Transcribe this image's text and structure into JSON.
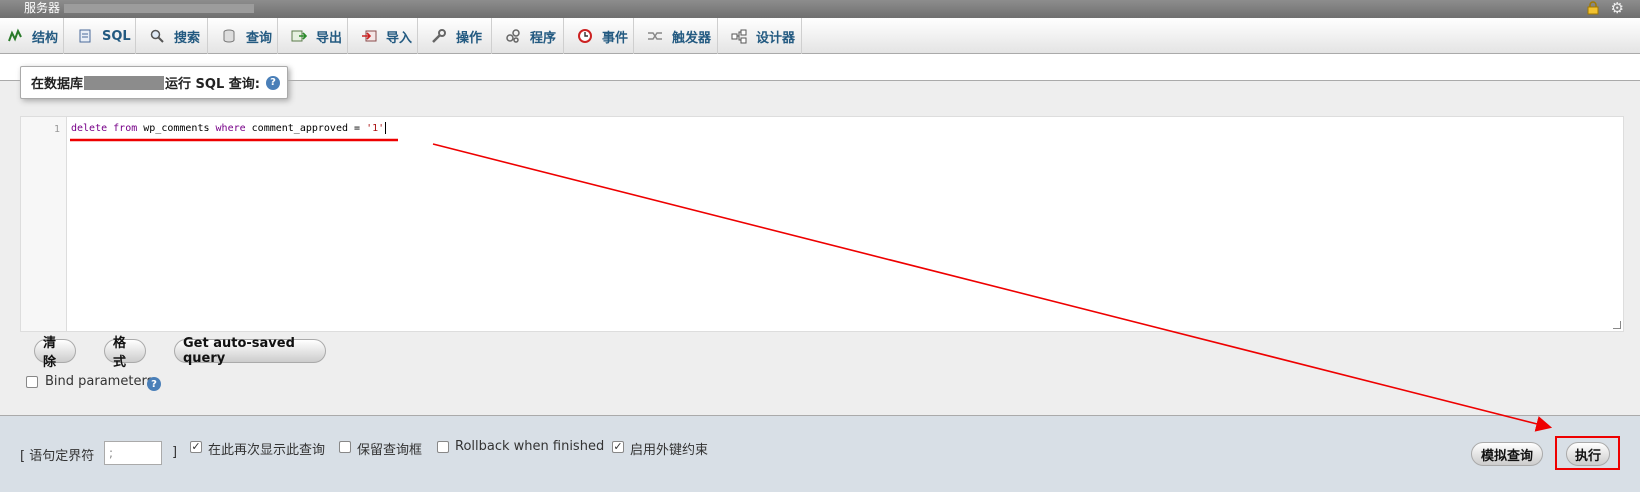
{
  "titlebar": {
    "crumb": "服务器"
  },
  "tabs": [
    {
      "label": "结构",
      "icon": "structure-icon"
    },
    {
      "label": "SQL",
      "icon": "sql-icon"
    },
    {
      "label": "搜索",
      "icon": "search-icon"
    },
    {
      "label": "查询",
      "icon": "query-icon"
    },
    {
      "label": "导出",
      "icon": "export-icon"
    },
    {
      "label": "导入",
      "icon": "import-icon"
    },
    {
      "label": "操作",
      "icon": "wrench-icon"
    },
    {
      "label": "程序",
      "icon": "routines-icon"
    },
    {
      "label": "事件",
      "icon": "clock-icon"
    },
    {
      "label": "触发器",
      "icon": "triggers-icon"
    },
    {
      "label": "设计器",
      "icon": "designer-icon"
    }
  ],
  "legend": {
    "prefix": "在数据库",
    "suffix": "运行 SQL 查询:",
    "help": "?"
  },
  "editor": {
    "line_number": "1",
    "tokens": [
      "delete",
      " ",
      "from",
      " wp_comments ",
      "where",
      " comment_approved = ",
      "'1'"
    ]
  },
  "buttons": {
    "clear": "清除",
    "format": "格式",
    "autosaved": "Get auto-saved query"
  },
  "bind_parameters": "Bind parameters",
  "bottom": {
    "delimiter_label": "[ 语句定界符",
    "delimiter_value": ";",
    "delimiter_close": "]",
    "show_again": "在此再次显示此查询",
    "retain_box": "保留查询框",
    "rollback": "Rollback when finished",
    "foreign_keys": "启用外键约束",
    "simulate": "模拟查询",
    "go": "执行"
  },
  "colors": {
    "tab_text": "#235a81",
    "annotation": "#ee0000",
    "bottom_bg": "#d8dfe6"
  }
}
